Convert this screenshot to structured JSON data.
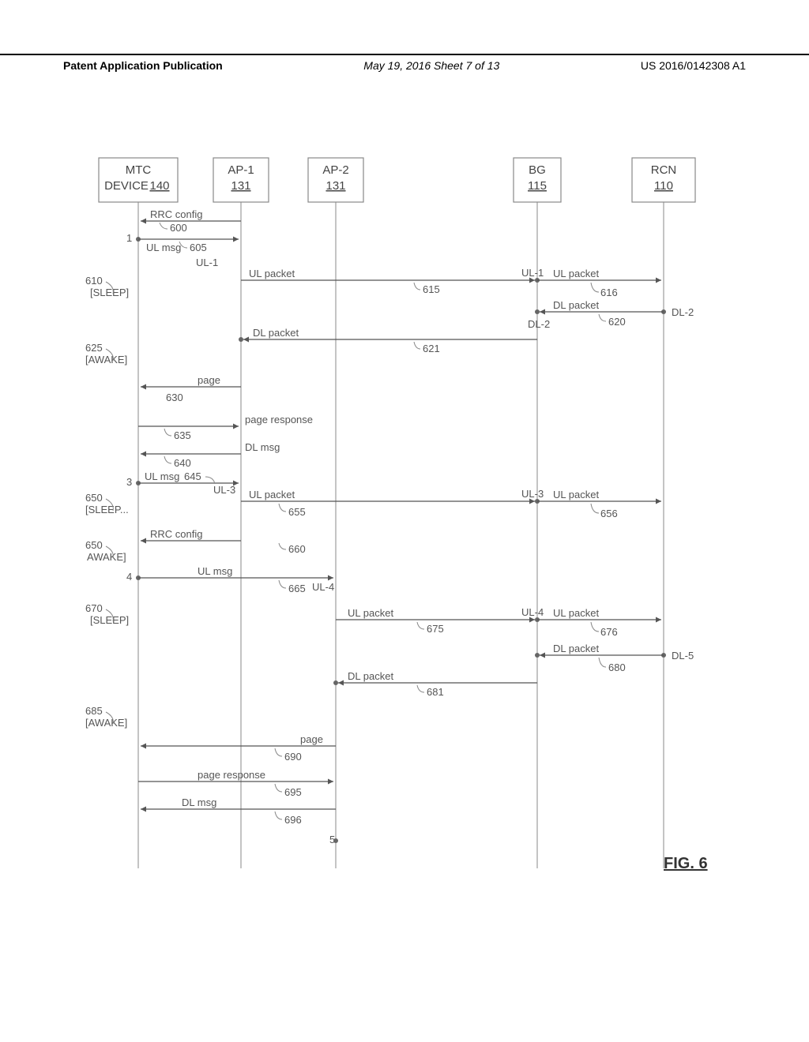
{
  "header": {
    "left": "Patent Application Publication",
    "center": "May 19, 2016  Sheet 7 of 13",
    "right": "US 2016/0142308 A1"
  },
  "figure_label": "FIG. 6",
  "entities": {
    "mtc": {
      "line1": "MTC",
      "line2": "DEVICE",
      "id": "140"
    },
    "ap1": {
      "name": "AP-1",
      "id": "131"
    },
    "ap2": {
      "name": "AP-2",
      "id": "131"
    },
    "bg": {
      "name": "BG",
      "id": "115"
    },
    "rcn": {
      "name": "RCN",
      "id": "110"
    }
  },
  "labels": {
    "rrc_config": "RRC config",
    "ul_msg": "UL msg",
    "ul_packet": "UL packet",
    "dl_packet": "DL packet",
    "dl_msg": "DL msg",
    "page": "page",
    "page_response": "page response"
  },
  "flow_ids": {
    "ul1": "UL-1",
    "dl2": "DL-2",
    "ul3": "UL-3",
    "ul4": "UL-4",
    "dl5": "DL-5"
  },
  "refs": {
    "r600": "600",
    "r605": "605",
    "r610": "610",
    "r615": "615",
    "r616": "616",
    "r620": "620",
    "r621": "621",
    "r625": "625",
    "r630": "630",
    "r635": "635",
    "r640": "640",
    "r645": "645",
    "r650": "650",
    "r650b": "650",
    "r655": "655",
    "r656": "656",
    "r660": "660",
    "r665": "665",
    "r670": "670",
    "r675": "675",
    "r676": "676",
    "r680": "680",
    "r681": "681",
    "r685": "685",
    "r690": "690",
    "r695": "695",
    "r696": "696"
  },
  "states": {
    "sleep": "[SLEEP]",
    "sleep_dots": "[SLEEP...",
    "awake": "AWAKE]",
    "awake_b": "[AWAKE]"
  },
  "ticks": {
    "t1": "1",
    "t3": "3",
    "t4": "4",
    "t5": "5"
  }
}
